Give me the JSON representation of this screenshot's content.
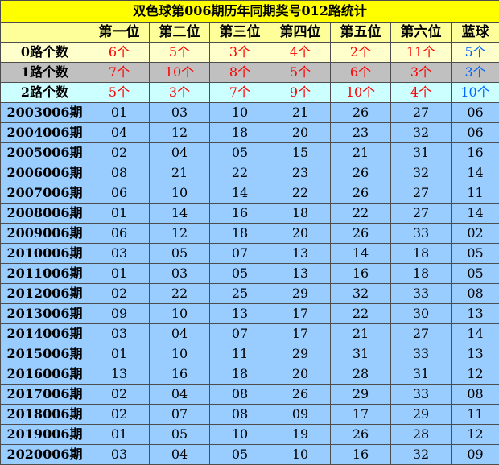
{
  "title": "双色球第006期历年同期奖号012路统计",
  "headers": [
    "",
    "第一位",
    "第二位",
    "第三位",
    "第四位",
    "第五位",
    "第六位",
    "蓝球"
  ],
  "stats": [
    {
      "label": "0路个数",
      "values": [
        "6个",
        "5个",
        "3个",
        "4个",
        "2个",
        "11个",
        "5个"
      ]
    },
    {
      "label": "1路个数",
      "values": [
        "7个",
        "10个",
        "8个",
        "5个",
        "6个",
        "3个",
        "3个"
      ]
    },
    {
      "label": "2路个数",
      "values": [
        "5个",
        "3个",
        "7个",
        "9个",
        "10个",
        "4个",
        "10个"
      ]
    }
  ],
  "rows": [
    {
      "period": "2003006期",
      "values": [
        "01",
        "03",
        "10",
        "21",
        "26",
        "27",
        "06"
      ]
    },
    {
      "period": "2004006期",
      "values": [
        "04",
        "12",
        "18",
        "20",
        "23",
        "32",
        "06"
      ]
    },
    {
      "period": "2005006期",
      "values": [
        "02",
        "04",
        "05",
        "15",
        "21",
        "31",
        "16"
      ]
    },
    {
      "period": "2006006期",
      "values": [
        "08",
        "21",
        "22",
        "23",
        "26",
        "32",
        "14"
      ]
    },
    {
      "period": "2007006期",
      "values": [
        "06",
        "10",
        "14",
        "22",
        "26",
        "27",
        "11"
      ]
    },
    {
      "period": "2008006期",
      "values": [
        "01",
        "14",
        "16",
        "18",
        "22",
        "27",
        "14"
      ]
    },
    {
      "period": "2009006期",
      "values": [
        "06",
        "12",
        "18",
        "20",
        "26",
        "33",
        "02"
      ]
    },
    {
      "period": "2010006期",
      "values": [
        "03",
        "05",
        "07",
        "13",
        "14",
        "18",
        "05"
      ]
    },
    {
      "period": "2011006期",
      "values": [
        "01",
        "03",
        "05",
        "13",
        "16",
        "18",
        "05"
      ]
    },
    {
      "period": "2012006期",
      "values": [
        "02",
        "22",
        "25",
        "29",
        "32",
        "33",
        "08"
      ]
    },
    {
      "period": "2013006期",
      "values": [
        "09",
        "10",
        "13",
        "17",
        "22",
        "30",
        "13"
      ]
    },
    {
      "period": "2014006期",
      "values": [
        "03",
        "04",
        "07",
        "17",
        "21",
        "27",
        "14"
      ]
    },
    {
      "period": "2015006期",
      "values": [
        "01",
        "10",
        "11",
        "29",
        "31",
        "33",
        "13"
      ]
    },
    {
      "period": "2016006期",
      "values": [
        "13",
        "16",
        "18",
        "20",
        "28",
        "31",
        "12"
      ]
    },
    {
      "period": "2017006期",
      "values": [
        "02",
        "04",
        "08",
        "26",
        "29",
        "33",
        "08"
      ]
    },
    {
      "period": "2018006期",
      "values": [
        "02",
        "07",
        "08",
        "09",
        "17",
        "29",
        "11"
      ]
    },
    {
      "period": "2019006期",
      "values": [
        "01",
        "05",
        "10",
        "19",
        "26",
        "28",
        "12"
      ]
    },
    {
      "period": "2020006期",
      "values": [
        "03",
        "04",
        "05",
        "10",
        "16",
        "32",
        "09"
      ]
    }
  ],
  "colors": {
    "title_bg": "#ffff00",
    "header_bg": "#ffff99",
    "row0_bg": "#ffffcc",
    "row1_bg": "#c0c0c0",
    "row2_bg": "#ccffff",
    "data_bg": "#99ccff",
    "count_red": "#ff0000",
    "count_blue": "#0066ff"
  }
}
